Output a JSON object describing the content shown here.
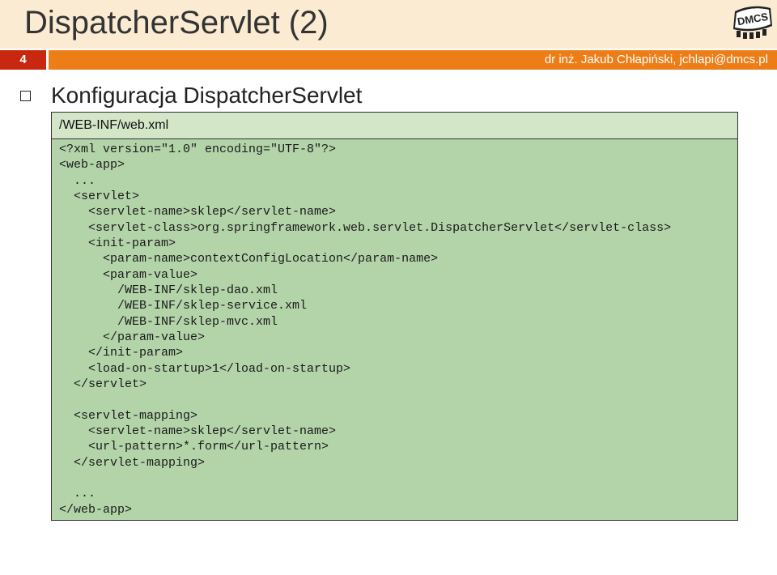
{
  "slide": {
    "title": "DispatcherServlet (2)",
    "number": "4",
    "author": "dr inż. Jakub Chłapiński, jchlapi@dmcs.pl",
    "logo_text": "DMCS"
  },
  "bullet": {
    "text": "Konfiguracja DispatcherServlet"
  },
  "file": {
    "path": "/WEB-INF/web.xml"
  },
  "code_lines": [
    "<?xml version=\"1.0\" encoding=\"UTF-8\"?>",
    "<web-app>",
    "  ...",
    "  <servlet>",
    "    <servlet-name>sklep</servlet-name>",
    "    <servlet-class>org.springframework.web.servlet.DispatcherServlet</servlet-class>",
    "    <init-param>",
    "      <param-name>contextConfigLocation</param-name>",
    "      <param-value>",
    "        /WEB-INF/sklep-dao.xml",
    "        /WEB-INF/sklep-service.xml",
    "        /WEB-INF/sklep-mvc.xml",
    "      </param-value>",
    "    </init-param>",
    "    <load-on-startup>1</load-on-startup>",
    "  </servlet>",
    "",
    "  <servlet-mapping>",
    "    <servlet-name>sklep</servlet-name>",
    "    <url-pattern>*.form</url-pattern>",
    "  </servlet-mapping>",
    "",
    "  ...",
    "</web-app>"
  ]
}
